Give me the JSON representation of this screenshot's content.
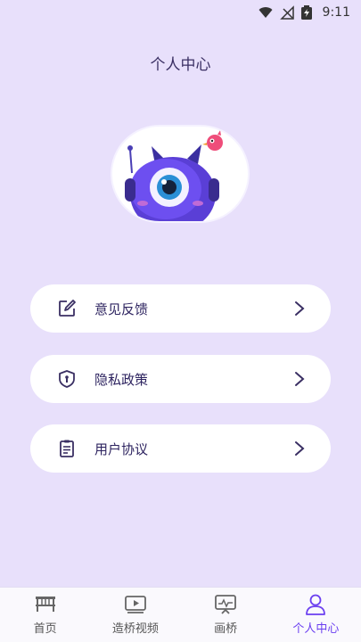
{
  "status_bar": {
    "time": "9:11"
  },
  "header": {
    "title": "个人中心"
  },
  "menu": [
    {
      "label": "意见反馈",
      "icon": "edit-icon"
    },
    {
      "label": "隐私政策",
      "icon": "shield-icon"
    },
    {
      "label": "用户协议",
      "icon": "clipboard-icon"
    }
  ],
  "tabs": [
    {
      "label": "首页",
      "icon": "home-icon",
      "active": false
    },
    {
      "label": "造桥视频",
      "icon": "video-icon",
      "active": false
    },
    {
      "label": "画桥",
      "icon": "monitor-icon",
      "active": false
    },
    {
      "label": "个人中心",
      "icon": "user-icon",
      "active": true
    }
  ],
  "colors": {
    "accent": "#6b3ff0",
    "background": "#e8e0fb",
    "text": "#2e2460"
  }
}
